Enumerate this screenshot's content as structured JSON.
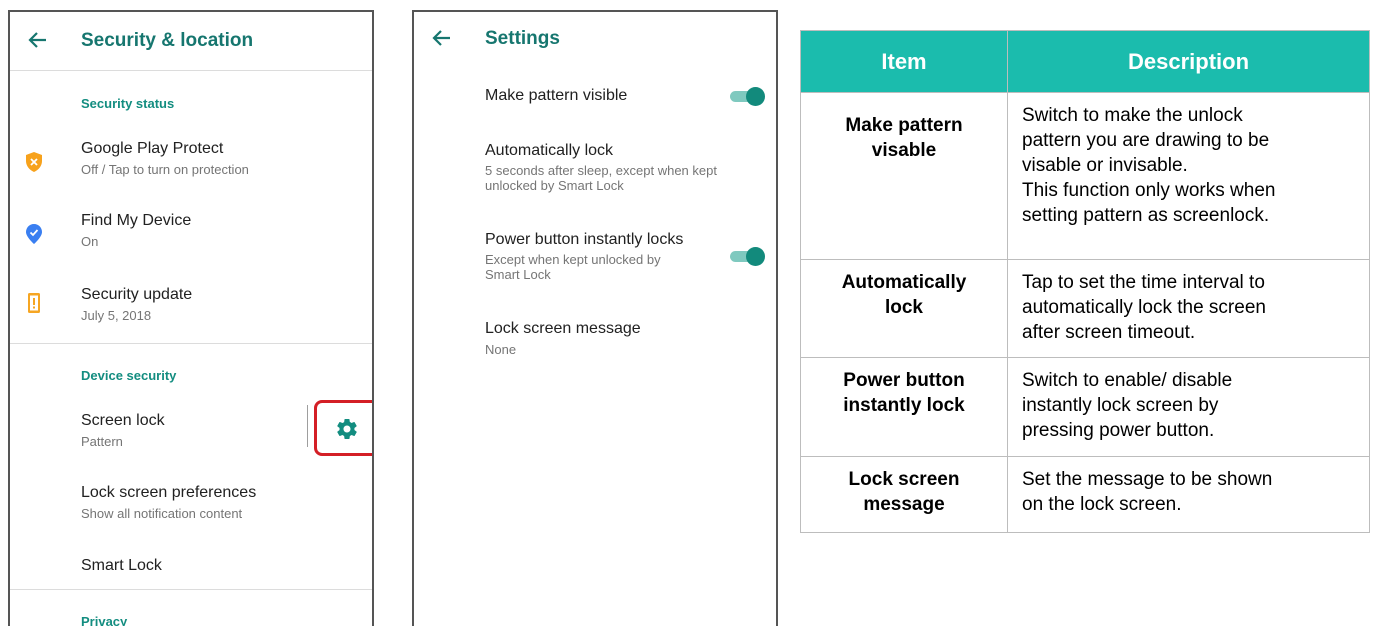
{
  "colors": {
    "accent": "#16766f",
    "teal_header": "#1bbcad",
    "highlight_red": "#d41f26",
    "shield_orange": "#f7a21c",
    "pin_blue": "#3a7ff1",
    "update_orange": "#f6a623"
  },
  "screen1": {
    "back_icon": "arrow-left-icon",
    "title": "Security & location",
    "section_security_status": "Security status",
    "items": [
      {
        "title": "Google Play Protect",
        "subtitle": "Off / Tap to turn on protection",
        "icon": "shield-warning-icon"
      },
      {
        "title": "Find My Device",
        "subtitle": "On",
        "icon": "location-check-icon"
      },
      {
        "title": "Security update",
        "subtitle": "July 5, 2018",
        "icon": "phone-alert-icon"
      }
    ],
    "section_device_security": "Device security",
    "screen_lock": {
      "title": "Screen lock",
      "subtitle": "Pattern",
      "settings_icon": "gear-icon"
    },
    "lock_prefs": {
      "title": "Lock screen preferences",
      "subtitle": "Show all notification content"
    },
    "smart_lock": {
      "title": "Smart Lock"
    },
    "section_privacy": "Privacy"
  },
  "screen2": {
    "back_icon": "arrow-left-icon",
    "title": "Settings",
    "items": [
      {
        "title": "Make pattern visible",
        "toggle_on": true
      },
      {
        "title": "Automatically lock",
        "subtitle_line1": "5 seconds after sleep, except when kept",
        "subtitle_line2": "unlocked by Smart Lock"
      },
      {
        "title": "Power button instantly locks",
        "subtitle_line1": "Except when kept unlocked by",
        "subtitle_line2": "Smart Lock",
        "toggle_on": true
      },
      {
        "title": "Lock screen message",
        "subtitle_line1": "None"
      }
    ]
  },
  "table": {
    "headers": [
      "Item",
      "Description"
    ],
    "rows": [
      {
        "name_line1": "Make pattern",
        "name_line2": "visable",
        "desc_lines": [
          "Switch to make the unlock",
          "pattern you are drawing to be",
          "visable or invisable.",
          "This function only works when",
          "setting pattern as screenlock."
        ]
      },
      {
        "name_line1": "Automatically",
        "name_line2": "lock",
        "desc_lines": [
          "Tap to set the time interval to",
          "automatically lock the screen",
          "after screen timeout."
        ]
      },
      {
        "name_line1": "Power button",
        "name_line2": "instantly lock",
        "desc_lines": [
          "Switch to enable/ disable",
          "instantly lock screen by",
          "pressing power button."
        ]
      },
      {
        "name_line1": "Lock screen",
        "name_line2": "message",
        "desc_lines": [
          "Set the message to be shown",
          "on the lock screen."
        ]
      }
    ]
  }
}
